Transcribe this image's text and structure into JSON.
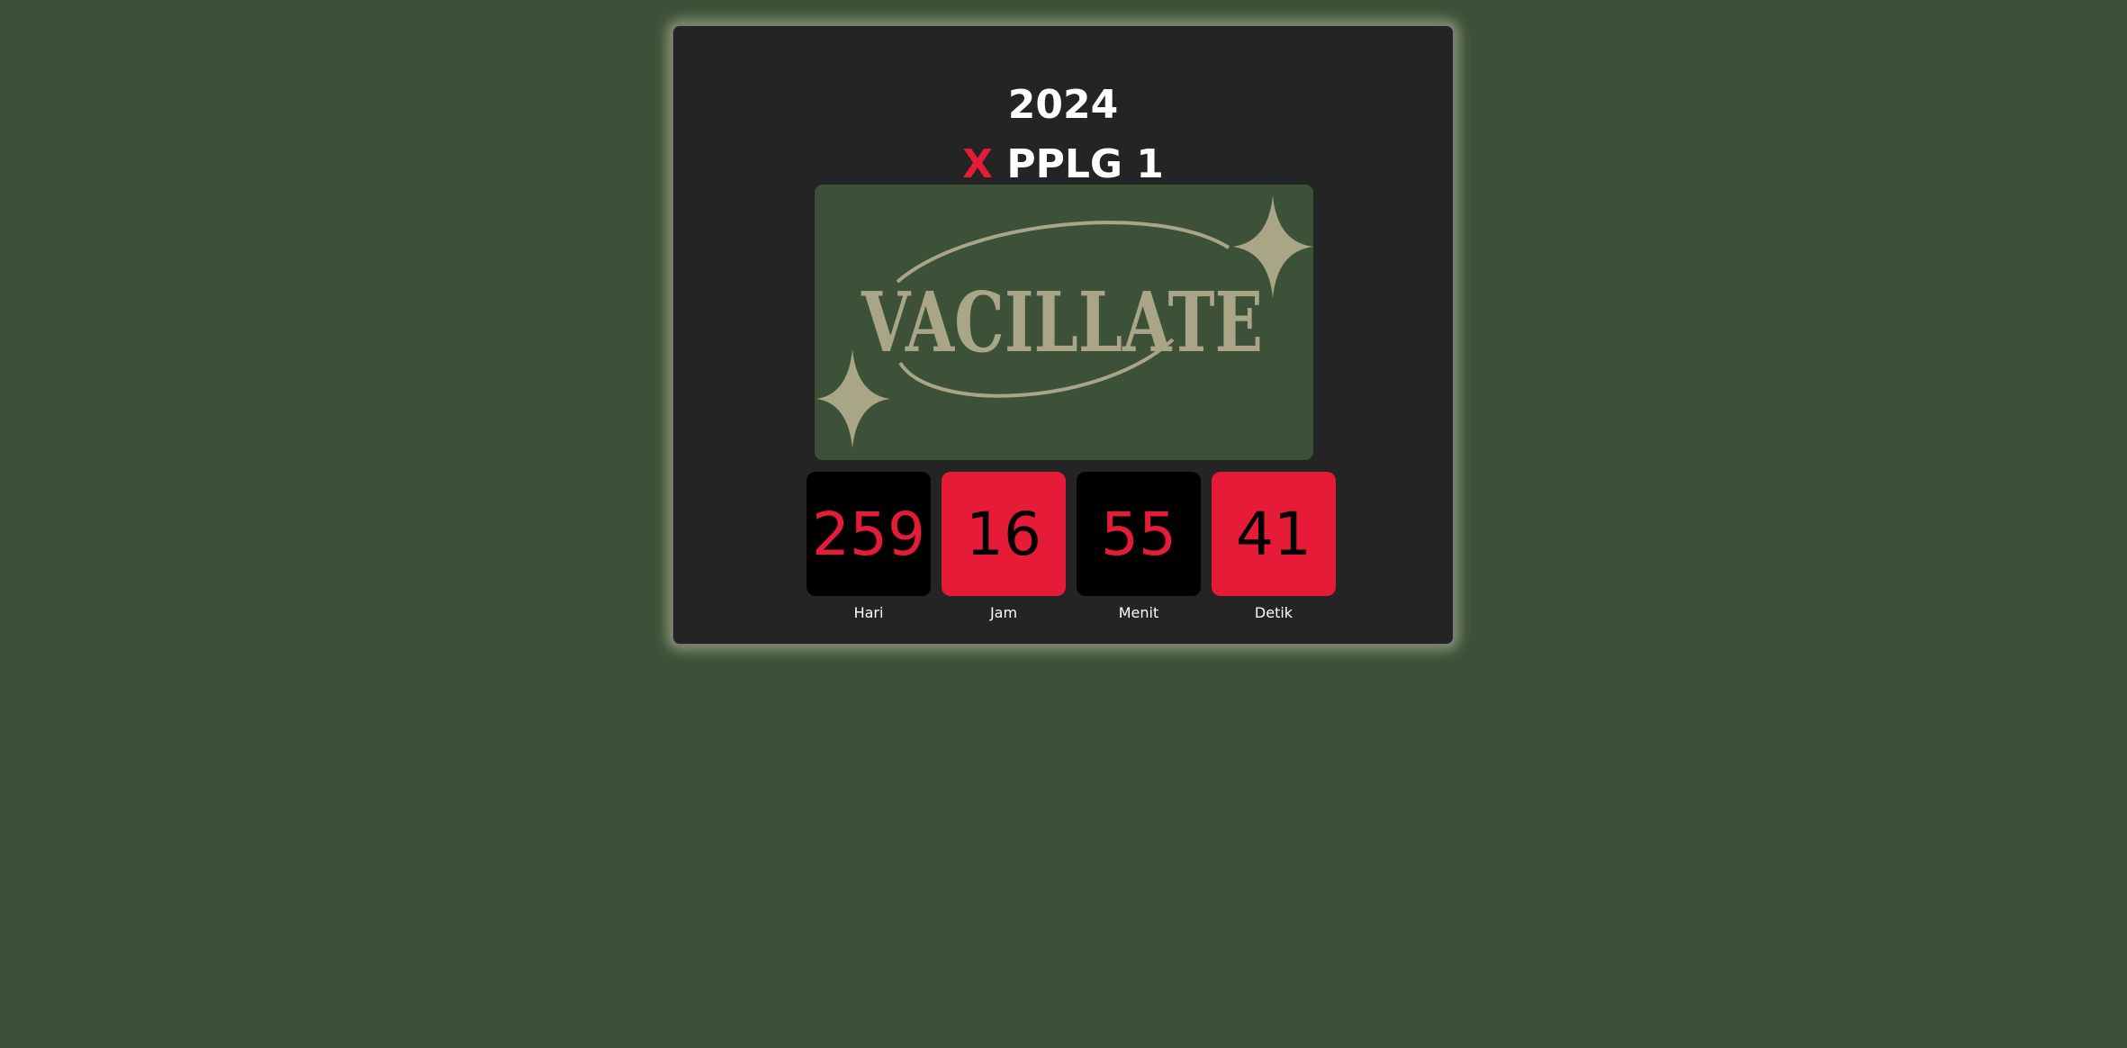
{
  "header": {
    "year": "2024",
    "class_prefix": "X",
    "class_name": "PPLG 1"
  },
  "logo": {
    "text": "VACILLATE"
  },
  "countdown": [
    {
      "value": "259",
      "label": "Hari"
    },
    {
      "value": "16",
      "label": "Jam"
    },
    {
      "value": "55",
      "label": "Menit"
    },
    {
      "value": "41",
      "label": "Detik"
    }
  ],
  "colors": {
    "background": "#3d5138",
    "card": "#242424",
    "accent_red": "#e61b38",
    "logo_ink": "#a9a587"
  }
}
